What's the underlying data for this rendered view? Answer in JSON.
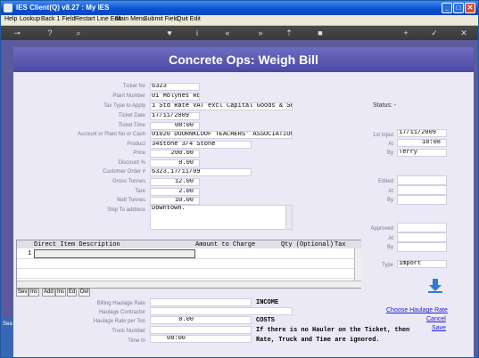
{
  "window": {
    "title": "IES Client(Q) v8.27 : My IES"
  },
  "menu": [
    "Help",
    "Lookup",
    "Back 1 Field",
    "Restart Line Edit",
    "Main Menu",
    "Submit Field",
    "Quit Edit"
  ],
  "form": {
    "title": "Concrete Ops: Weigh Bill",
    "labels": {
      "ticket_no": "Ticket No",
      "plant_number": "Plant Number",
      "tax_type": "Tax Type to Apply",
      "ticket_date": "Ticket Date",
      "ticket_time": "Ticket Time",
      "account": "Account or Plant No or Cash",
      "product": "Product",
      "price": "Price",
      "discount": "Discount %",
      "customer_order": "Customer Order #",
      "gross_tonnes": "Gross Tonnes",
      "tare": "Tare",
      "nett_tonnes": "Nett Tonnes",
      "ship_to": "Ship To address"
    },
    "values": {
      "ticket_no": "6323",
      "plant_number": "01 Molynes Rd",
      "tax_type": "1 Std Rate VAT excl Capital Goods & Service",
      "ticket_date": "17/11/2009",
      "ticket_time": "08:00",
      "account": "01020 DOORNKLOOF TEACHERS' ASSOCIATION",
      "product": "34stone 3/4 Stone",
      "price": "200.00",
      "discount": "0.00",
      "customer_order": "6323.17/11/09",
      "gross_tonnes": "12.00",
      "tare": "2.00",
      "nett_tonnes": "10.00",
      "ship_to": "Downtown."
    }
  },
  "status": {
    "label": "Status: -",
    "first_input_label": "1st Input",
    "first_input_value": "17/11/2009",
    "at_label": "At",
    "at_value": "18:08",
    "by_label": "By",
    "by_value": "Terry",
    "edited_label": "Edited",
    "edited_at_label": "At",
    "edited_by_label": "By",
    "approved_label": "Approved",
    "approved_at_label": "At",
    "approved_by_label": "By",
    "type_label": "Type",
    "type_value": "import"
  },
  "grid": {
    "columns": [
      "Direct Item Description",
      "Amount to Charge",
      "Qty (Optional)",
      "Tax"
    ],
    "row_number": "1",
    "tabs": [
      "Sev",
      "Ins",
      "Add",
      "Ins",
      "Ed",
      "Del"
    ]
  },
  "haulage": {
    "billing_rate_label": "Billing Haulage Rate",
    "contractor_label": "Haulage Contractor",
    "rate_per_ton_label": "Haulage Rate per Ton",
    "rate_per_ton_value": "0.00",
    "truck_number_label": "Truck Number",
    "time_in_label": "Time In",
    "time_in_value": "08:00",
    "income": "INCOME",
    "costs": "COSTS",
    "note_line1": "If there is no Hauler on the Ticket, then",
    "note_line2": "Rate, Truck and Time are ignored."
  },
  "links": {
    "choose_haulage_rate": "Choose Haulage Rate",
    "cancel": "Cancel",
    "save": "Save"
  },
  "taskbar_label": "Sea"
}
